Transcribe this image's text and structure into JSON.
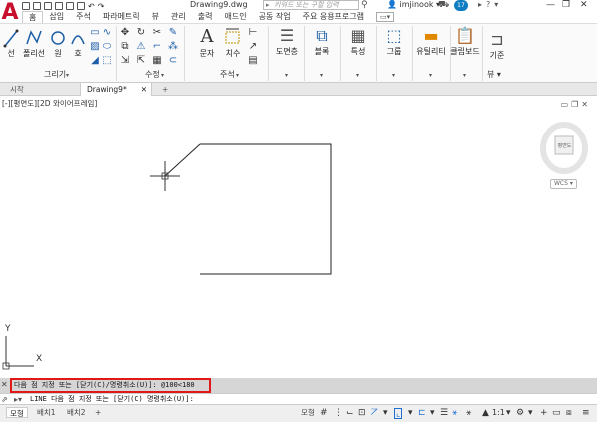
{
  "app": {
    "document_title": "Drawing9.dwg",
    "search_placeholder": "키워드 또는 구할 입력",
    "user": "imjinook",
    "notification_count": "17"
  },
  "ribbon_tabs": [
    "홈",
    "삽입",
    "주석",
    "파라메트릭",
    "뷰",
    "관리",
    "출력",
    "애드인",
    "공동 작업",
    "주요 응용프로그램"
  ],
  "ribbon": {
    "draw": {
      "line": "선",
      "polyline": "폴리선",
      "circle": "원",
      "arc": "호",
      "panel": "그리기"
    },
    "modify": {
      "panel": "수정"
    },
    "annotation": {
      "text": "문자",
      "dimension": "치수",
      "panel": "주석"
    },
    "layers": {
      "label": "도면층"
    },
    "block": {
      "label": "블록"
    },
    "properties": {
      "label": "특성"
    },
    "groups": {
      "label": "그룹"
    },
    "utilities": {
      "label": "유틸리티"
    },
    "clipboard": {
      "label": "클립보드"
    },
    "view": {
      "label": "기준",
      "panel": "뷰"
    }
  },
  "file_tabs": [
    "시작",
    "Drawing9*"
  ],
  "viewport": {
    "label": "[-][평면도][2D 와이어프레임]",
    "viewcube_face": "평면도",
    "wcs": "WCS",
    "ucs_x": "X",
    "ucs_y": "Y"
  },
  "command": {
    "history": "다음 점 지정 또는 [닫기(C)/명령취소(U)]: @100<180",
    "prompt": "LINE 다음 점 지정 또는 [닫기(C) 명령취소(U)]:"
  },
  "status": {
    "tabs": [
      "모형",
      "배치1",
      "배치2"
    ],
    "model": "모형",
    "scale": "1:1"
  },
  "colors": {
    "brand": "#c8102e",
    "accent": "#1c6fd0",
    "highlight": "#e01818"
  }
}
